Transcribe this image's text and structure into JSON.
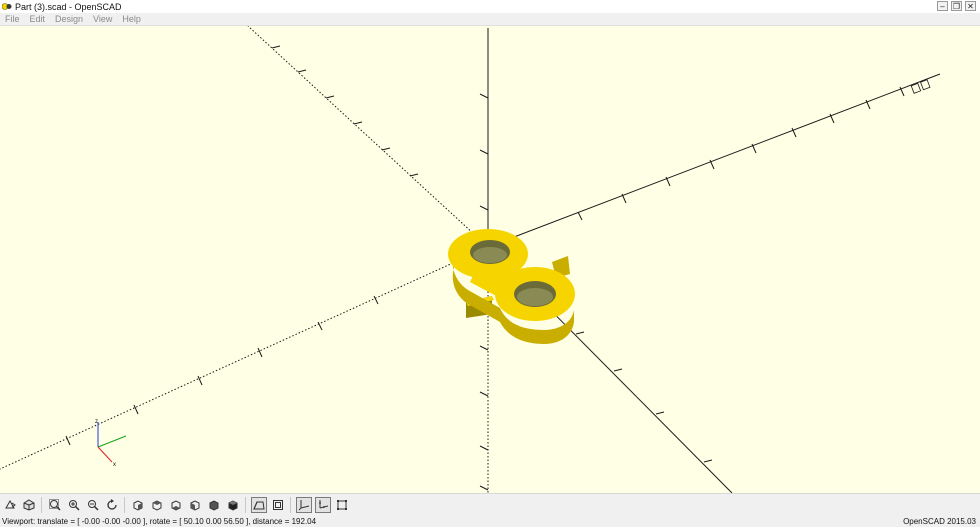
{
  "window": {
    "title": "Part (3).scad - OpenSCAD",
    "minimize_icon": "minimize-icon",
    "restore_icon": "restore-icon",
    "close_icon": "close-icon"
  },
  "menu": {
    "file": "File",
    "edit": "Edit",
    "design": "Design",
    "view": "View",
    "help": "Help"
  },
  "viewport": {
    "background_color": "#ffffe5",
    "model_color": "#f5d400",
    "model_side_color": "#c9ae00",
    "axis_color": "#1a1a1a"
  },
  "toolbar": {
    "buttons": [
      {
        "name": "preview-icon"
      },
      {
        "name": "render-icon"
      },
      {
        "name": "view-all-icon"
      },
      {
        "name": "zoom-in-icon"
      },
      {
        "name": "zoom-out-icon"
      },
      {
        "name": "reset-view-icon"
      },
      {
        "name": "view-right-icon"
      },
      {
        "name": "view-top-icon"
      },
      {
        "name": "view-bottom-icon"
      },
      {
        "name": "view-left-icon"
      },
      {
        "name": "view-front-icon"
      },
      {
        "name": "view-back-icon"
      },
      {
        "name": "perspective-icon"
      },
      {
        "name": "orthogonal-icon"
      },
      {
        "name": "show-axes-icon"
      },
      {
        "name": "show-scale-markers-icon"
      },
      {
        "name": "show-edges-icon"
      }
    ]
  },
  "status": {
    "viewport": "Viewport: translate = [ -0.00 -0.00 -0.00 ], rotate = [ 50.10 0.00 56.50 ], distance = 192.04",
    "version": "OpenSCAD 2015.03"
  }
}
